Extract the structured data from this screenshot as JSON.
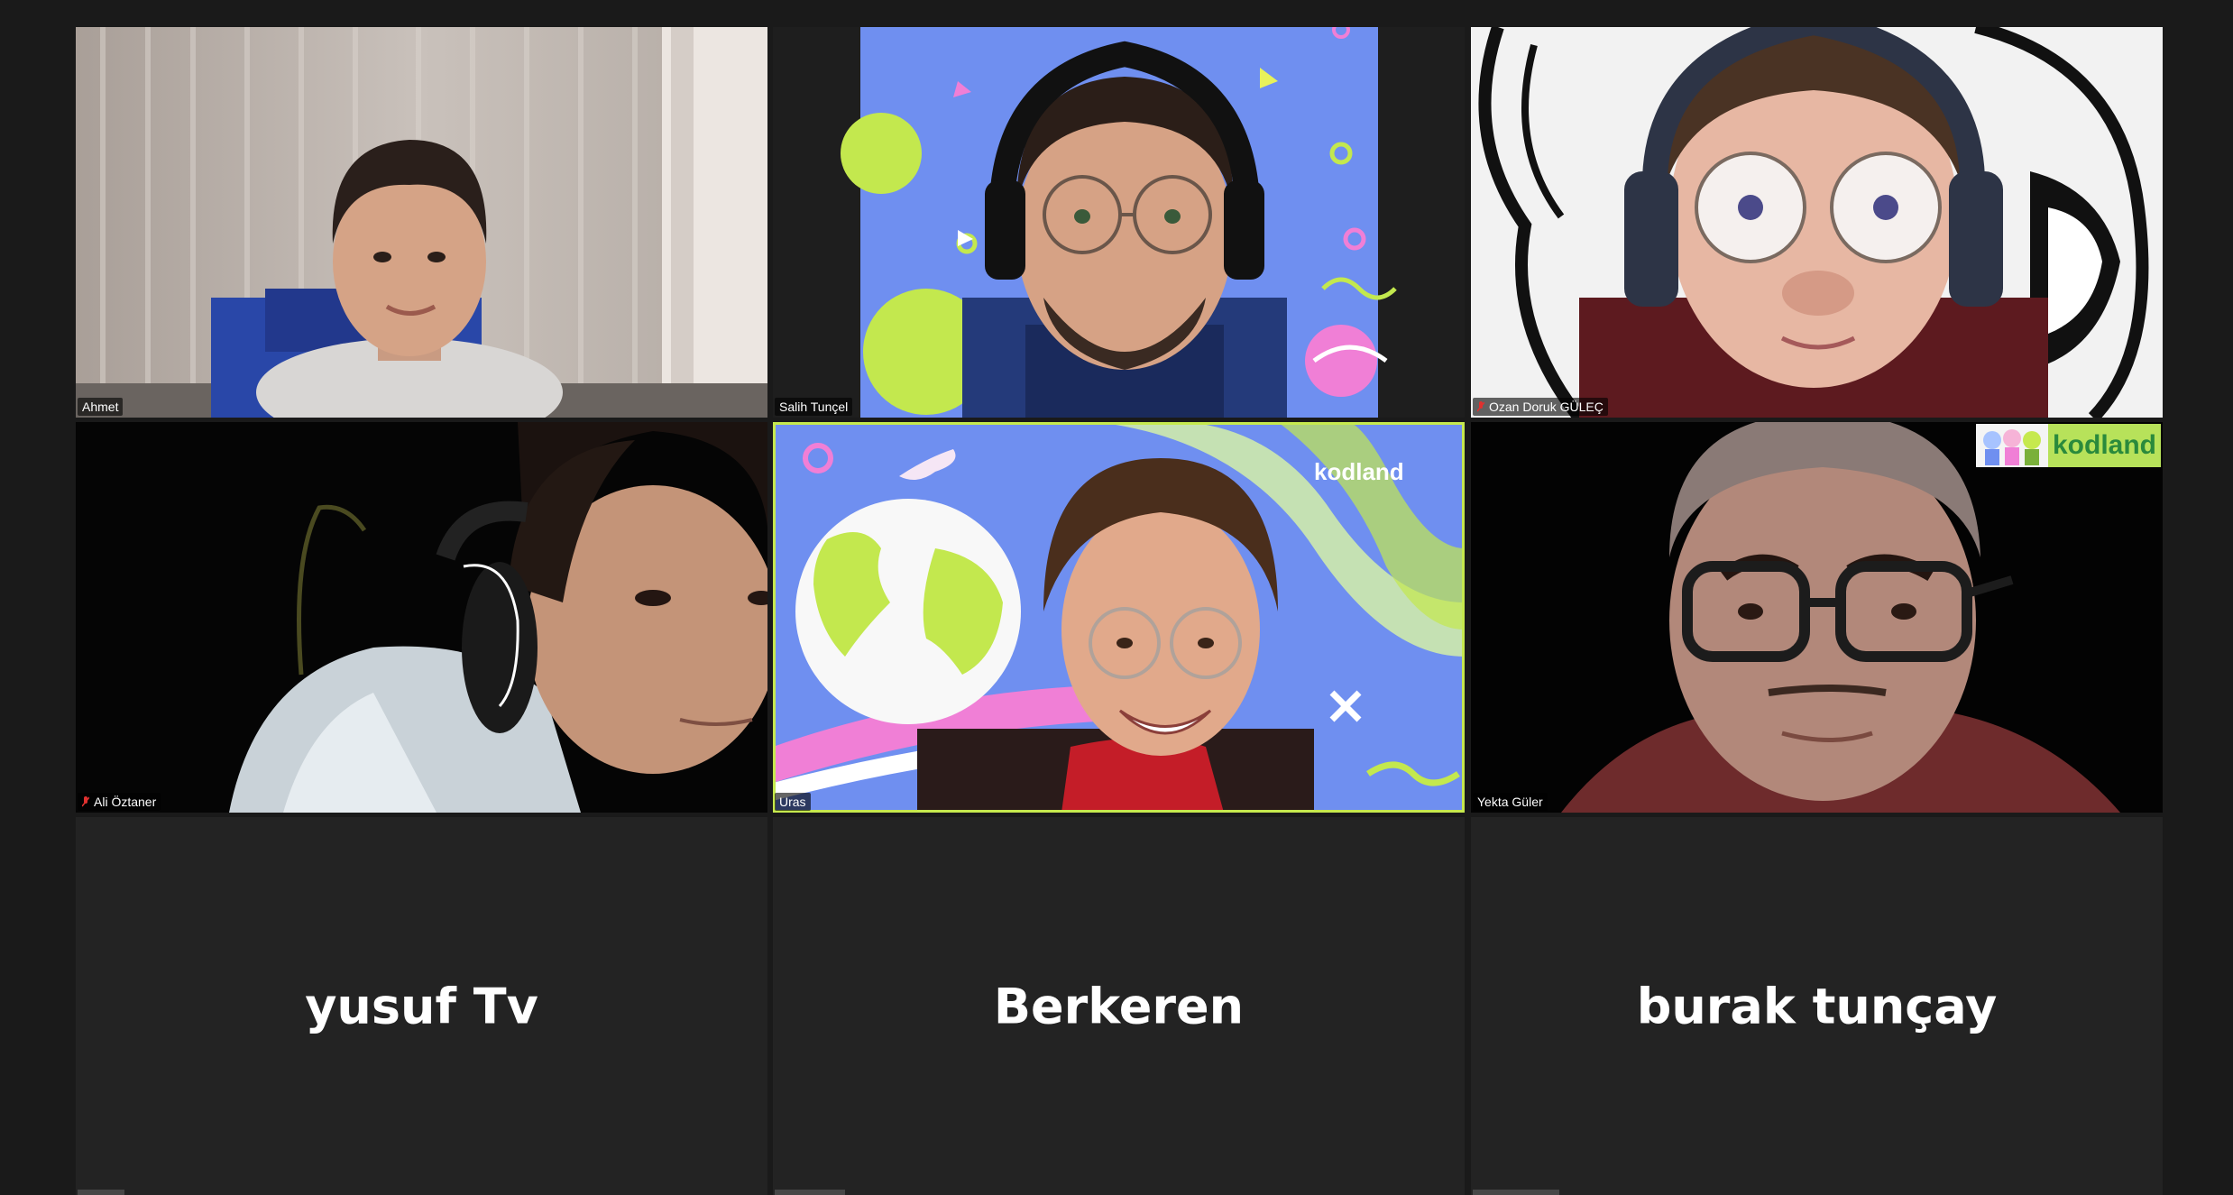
{
  "meeting": {
    "participants": [
      {
        "name": "Ahmet",
        "muted": false
      },
      {
        "name": "Salih Tunçel",
        "muted": false
      },
      {
        "name": "Ozan Doruk GÜLEÇ",
        "muted": true
      },
      {
        "name": "Ali Öztaner",
        "muted": true
      },
      {
        "name": "Uras",
        "muted": false,
        "active_speaker": true
      },
      {
        "name": "Yekta Güler",
        "muted": false
      },
      {
        "name": "yusuf Tv",
        "video_off": true
      },
      {
        "name": "Berkeren",
        "video_off": true
      },
      {
        "name": "burak tunçay",
        "video_off": true
      }
    ],
    "backgrounds": {
      "uras_logo": "kodland",
      "yekta_badge": "kodland"
    }
  },
  "colors": {
    "active_speaker_border": "#c6e94e",
    "muted_mic": "#e0312f",
    "background": "#1a1a1a",
    "empty_tile": "#232323",
    "kodland_blue": "#6f8ff0",
    "kodland_lime": "#c3e84e"
  },
  "icons": [
    "muted-mic-icon"
  ]
}
